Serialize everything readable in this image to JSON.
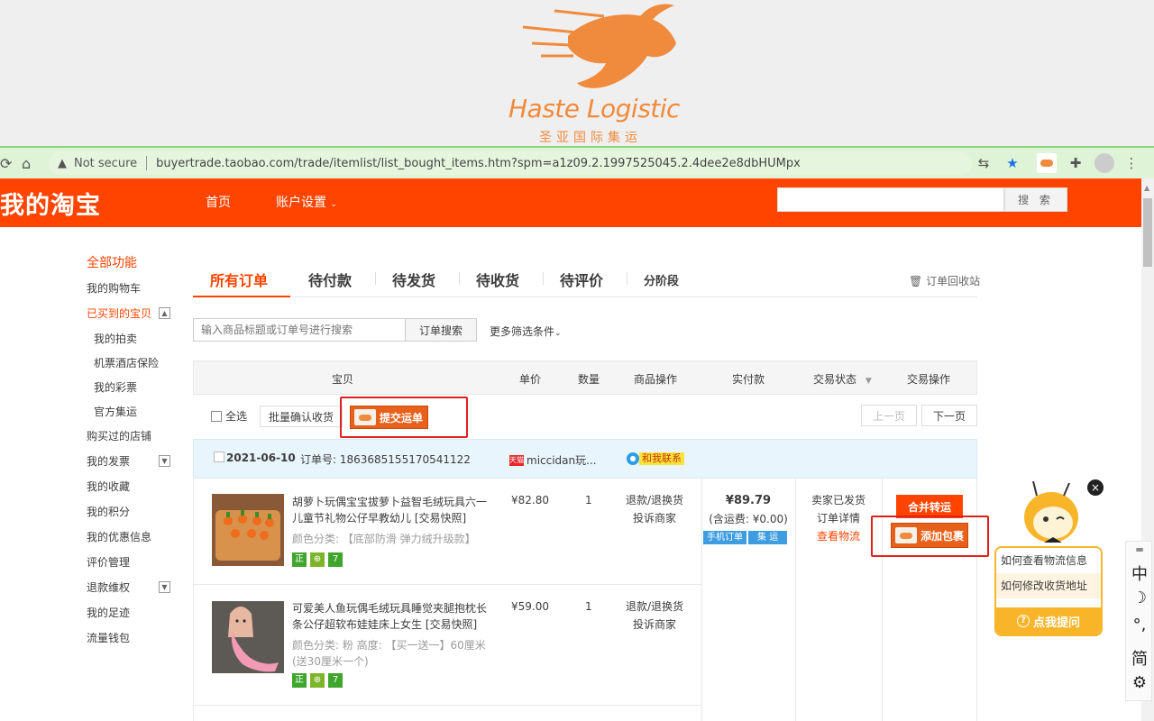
{
  "banner": {
    "logo_text": "Haste Logistic",
    "logo_sub": "圣亚国际集运"
  },
  "browser": {
    "security_label": "Not secure",
    "url": "buyertrade.taobao.com/trade/itemlist/list_bought_items.htm?spm=a1z09.2.1997525045.2.4dee2e8dbHUMpx"
  },
  "header": {
    "logo": "我的淘宝",
    "nav_home": "首页",
    "nav_account": "账户设置",
    "search_button": "搜 索"
  },
  "sidebar": {
    "items": [
      {
        "label": "全部功能"
      },
      {
        "label": "我的购物车"
      },
      {
        "label": "已买到的宝贝"
      },
      {
        "label": "我的拍卖"
      },
      {
        "label": "机票酒店保险"
      },
      {
        "label": "我的彩票"
      },
      {
        "label": "官方集运"
      },
      {
        "label": "购买过的店铺"
      },
      {
        "label": "我的发票"
      },
      {
        "label": "我的收藏"
      },
      {
        "label": "我的积分"
      },
      {
        "label": "我的优惠信息"
      },
      {
        "label": "评价管理"
      },
      {
        "label": "退款维权"
      },
      {
        "label": "我的足迹"
      },
      {
        "label": "流量钱包"
      }
    ]
  },
  "tabs": [
    "所有订单",
    "待付款",
    "待发货",
    "待收货",
    "待评价",
    "分阶段"
  ],
  "recycle_bin": "订单回收站",
  "search": {
    "placeholder": "输入商品标题或订单号进行搜索",
    "button": "订单搜索",
    "more_filters": "更多筛选条件"
  },
  "table_headers": [
    "宝贝",
    "单价",
    "数量",
    "商品操作",
    "实付款",
    "交易状态",
    "交易操作"
  ],
  "batch": {
    "select_all": "全选",
    "confirm_receipt": "批量确认收货",
    "submit_waybill": "提交运单",
    "prev_page": "上一页",
    "next_page": "下一页"
  },
  "order": {
    "date": "2021-06-10",
    "order_no": "订单号: 1863685155170541122",
    "shop": "miccidan玩...",
    "shop_badge": "天猫",
    "contact": "和我联系",
    "items": [
      {
        "title": "胡萝卜玩偶宝宝拔萝卜益智毛绒玩具六一儿童节礼物公仔早教幼儿 [交易快照]",
        "spec": "颜色分类: 【底部防滑 弹力绒升级款】",
        "price": "¥82.80",
        "qty": "1",
        "op1": "退款/退换货",
        "op2": "投诉商家"
      },
      {
        "title": "可爱美人鱼玩偶毛绒玩具睡觉夹腿抱枕长条公仔超软布娃娃床上女生 [交易快照]",
        "spec": "颜色分类: 粉  高度: 【买一送一】60厘米 (送30厘米一个)",
        "price": "¥59.00",
        "qty": "1",
        "op1": "退款/退换货",
        "op2": "投诉商家"
      }
    ],
    "badge_labels": [
      "正",
      "⊕",
      "7"
    ],
    "total": "¥89.79",
    "shipping": "(含运费: ¥0.00)",
    "tag_mobile": "手机订单",
    "tag_ship": "集 运",
    "status": "卖家已发货",
    "detail": "订单详情",
    "track": "查看物流",
    "merge_ship": "合并转运",
    "add_package": "添加包裹"
  },
  "help": {
    "q1": "如何查看物流信息",
    "q2": "如何修改收货地址",
    "ask": "点我提问"
  },
  "ime": {
    "lang": "中",
    "punct": "°,",
    "simp": "简"
  },
  "colors": {
    "taobao_orange": "#ff4400",
    "haste_orange": "#f08a3c",
    "help_yellow": "#f8b52a"
  }
}
